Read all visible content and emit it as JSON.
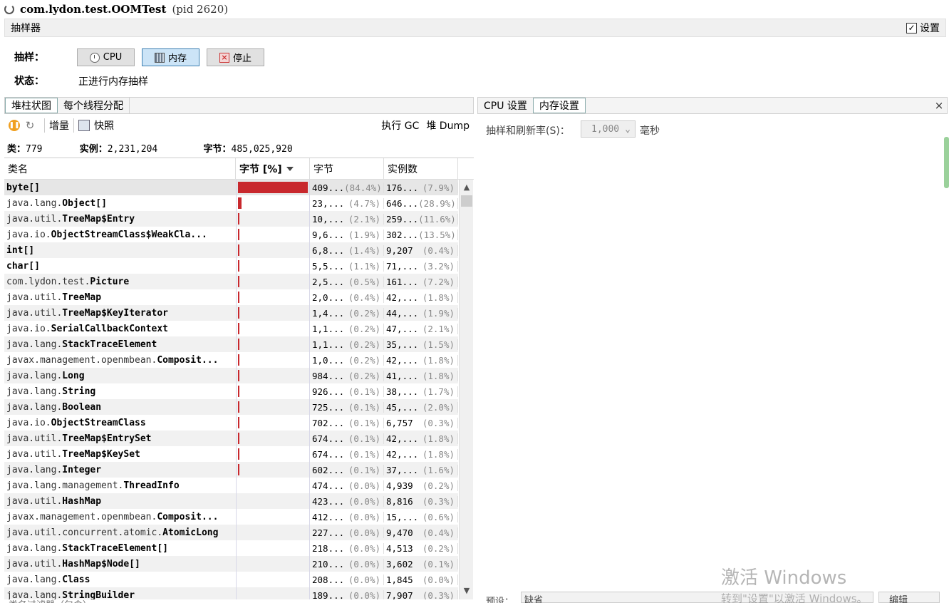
{
  "title": {
    "app": "com.lydon.test.OOMTest",
    "pid": "(pid 2620)"
  },
  "sampler": {
    "header": "抽样器",
    "settings_label": "设置",
    "settings_checked": true
  },
  "controls": {
    "sample_label": "抽样：",
    "status_label": "状态：",
    "cpu_button": "CPU",
    "memory_button": "内存",
    "stop_button": "停止",
    "status_value": "正进行内存抽样"
  },
  "left_tabs": {
    "heap": "堆柱状图",
    "per_thread": "每个线程分配"
  },
  "toolbar": {
    "delta": "增量",
    "snapshot": "快照",
    "run_gc": "执行 GC",
    "heap_dump": "堆 Dump"
  },
  "stats": {
    "classes_label": "类：",
    "classes_value": "779",
    "instances_label": "实例：",
    "instances_value": "2,231,204",
    "bytes_label": "字节：",
    "bytes_value": "485,025,920"
  },
  "table": {
    "columns": {
      "name": "类名",
      "bytes_pct": "字节 [%]",
      "bytes": "字节",
      "instances": "实例数"
    },
    "rows": [
      {
        "pkg": "",
        "cls": "byte[]",
        "pct": 84.4,
        "bytes": "409...",
        "bytes_pct": "(84.4%)",
        "inst": "176...",
        "inst_pct": "(7.9%)"
      },
      {
        "pkg": "java.lang.",
        "cls": "Object[]",
        "pct": 4.7,
        "bytes": "23,...",
        "bytes_pct": "(4.7%)",
        "inst": "646...",
        "inst_pct": "(28.9%)"
      },
      {
        "pkg": "java.util.",
        "cls": "TreeMap$Entry",
        "pct": 2.1,
        "bytes": "10,...",
        "bytes_pct": "(2.1%)",
        "inst": "259...",
        "inst_pct": "(11.6%)"
      },
      {
        "pkg": "java.io.",
        "cls": "ObjectStreamClass$WeakCla...",
        "pct": 1.9,
        "bytes": "9,6...",
        "bytes_pct": "(1.9%)",
        "inst": "302...",
        "inst_pct": "(13.5%)"
      },
      {
        "pkg": "",
        "cls": "int[]",
        "pct": 1.4,
        "bytes": "6,8...",
        "bytes_pct": "(1.4%)",
        "inst": "9,207",
        "inst_pct": "(0.4%)"
      },
      {
        "pkg": "",
        "cls": "char[]",
        "pct": 1.1,
        "bytes": "5,5...",
        "bytes_pct": "(1.1%)",
        "inst": "71,...",
        "inst_pct": "(3.2%)"
      },
      {
        "pkg": "com.lydon.test.",
        "cls": "Picture",
        "pct": 0.5,
        "bytes": "2,5...",
        "bytes_pct": "(0.5%)",
        "inst": "161...",
        "inst_pct": "(7.2%)"
      },
      {
        "pkg": "java.util.",
        "cls": "TreeMap",
        "pct": 0.4,
        "bytes": "2,0...",
        "bytes_pct": "(0.4%)",
        "inst": "42,...",
        "inst_pct": "(1.8%)"
      },
      {
        "pkg": "java.util.",
        "cls": "TreeMap$KeyIterator",
        "pct": 0.2,
        "bytes": "1,4...",
        "bytes_pct": "(0.2%)",
        "inst": "44,...",
        "inst_pct": "(1.9%)"
      },
      {
        "pkg": "java.io.",
        "cls": "SerialCallbackContext",
        "pct": 0.2,
        "bytes": "1,1...",
        "bytes_pct": "(0.2%)",
        "inst": "47,...",
        "inst_pct": "(2.1%)"
      },
      {
        "pkg": "java.lang.",
        "cls": "StackTraceElement",
        "pct": 0.2,
        "bytes": "1,1...",
        "bytes_pct": "(0.2%)",
        "inst": "35,...",
        "inst_pct": "(1.5%)"
      },
      {
        "pkg": "javax.management.openmbean.",
        "cls": "Composit...",
        "pct": 0.2,
        "bytes": "1,0...",
        "bytes_pct": "(0.2%)",
        "inst": "42,...",
        "inst_pct": "(1.8%)"
      },
      {
        "pkg": "java.lang.",
        "cls": "Long",
        "pct": 0.2,
        "bytes": "984...",
        "bytes_pct": "(0.2%)",
        "inst": "41,...",
        "inst_pct": "(1.8%)"
      },
      {
        "pkg": "java.lang.",
        "cls": "String",
        "pct": 0.1,
        "bytes": "926...",
        "bytes_pct": "(0.1%)",
        "inst": "38,...",
        "inst_pct": "(1.7%)"
      },
      {
        "pkg": "java.lang.",
        "cls": "Boolean",
        "pct": 0.1,
        "bytes": "725...",
        "bytes_pct": "(0.1%)",
        "inst": "45,...",
        "inst_pct": "(2.0%)"
      },
      {
        "pkg": "java.io.",
        "cls": "ObjectStreamClass",
        "pct": 0.1,
        "bytes": "702...",
        "bytes_pct": "(0.1%)",
        "inst": "6,757",
        "inst_pct": "(0.3%)"
      },
      {
        "pkg": "java.util.",
        "cls": "TreeMap$EntrySet",
        "pct": 0.1,
        "bytes": "674...",
        "bytes_pct": "(0.1%)",
        "inst": "42,...",
        "inst_pct": "(1.8%)"
      },
      {
        "pkg": "java.util.",
        "cls": "TreeMap$KeySet",
        "pct": 0.1,
        "bytes": "674...",
        "bytes_pct": "(0.1%)",
        "inst": "42,...",
        "inst_pct": "(1.8%)"
      },
      {
        "pkg": "java.lang.",
        "cls": "Integer",
        "pct": 0.1,
        "bytes": "602...",
        "bytes_pct": "(0.1%)",
        "inst": "37,...",
        "inst_pct": "(1.6%)"
      },
      {
        "pkg": "java.lang.management.",
        "cls": "ThreadInfo",
        "pct": 0.0,
        "bytes": "474...",
        "bytes_pct": "(0.0%)",
        "inst": "4,939",
        "inst_pct": "(0.2%)"
      },
      {
        "pkg": "java.util.",
        "cls": "HashMap",
        "pct": 0.0,
        "bytes": "423...",
        "bytes_pct": "(0.0%)",
        "inst": "8,816",
        "inst_pct": "(0.3%)"
      },
      {
        "pkg": "javax.management.openmbean.",
        "cls": "Composit...",
        "pct": 0.0,
        "bytes": "412...",
        "bytes_pct": "(0.0%)",
        "inst": "15,...",
        "inst_pct": "(0.6%)"
      },
      {
        "pkg": "java.util.concurrent.atomic.",
        "cls": "AtomicLong",
        "pct": 0.0,
        "bytes": "227...",
        "bytes_pct": "(0.0%)",
        "inst": "9,470",
        "inst_pct": "(0.4%)"
      },
      {
        "pkg": "java.lang.",
        "cls": "StackTraceElement[]",
        "pct": 0.0,
        "bytes": "218...",
        "bytes_pct": "(0.0%)",
        "inst": "4,513",
        "inst_pct": "(0.2%)"
      },
      {
        "pkg": "java.util.",
        "cls": "HashMap$Node[]",
        "pct": 0.0,
        "bytes": "210...",
        "bytes_pct": "(0.0%)",
        "inst": "3,602",
        "inst_pct": "(0.1%)"
      },
      {
        "pkg": "java.lang.",
        "cls": "Class",
        "pct": 0.0,
        "bytes": "208...",
        "bytes_pct": "(0.0%)",
        "inst": "1,845",
        "inst_pct": "(0.0%)"
      },
      {
        "pkg": "java.lang.",
        "cls": "StringBuilder",
        "pct": 0.0,
        "bytes": "189...",
        "bytes_pct": "(0.0%)",
        "inst": "7,907",
        "inst_pct": "(0.3%)"
      }
    ]
  },
  "filter": {
    "placeholder": "类名过滤器（包含）"
  },
  "right_tabs": {
    "cpu_settings": "CPU 设置",
    "memory_settings": "内存设置",
    "close": "×"
  },
  "memory_settings": {
    "rate_label": "抽样和刷新率(S)：",
    "rate_value": "1,000",
    "rate_unit": "毫秒"
  },
  "preset": {
    "label": "预设：",
    "value": "缺省",
    "edit": "编辑"
  },
  "watermark": {
    "line1": "激活 Windows",
    "line2": "转到\"设置\"以激活 Windows。"
  },
  "colors": {
    "bar": "#c8282d",
    "selected_tab": "#cce4f7"
  }
}
